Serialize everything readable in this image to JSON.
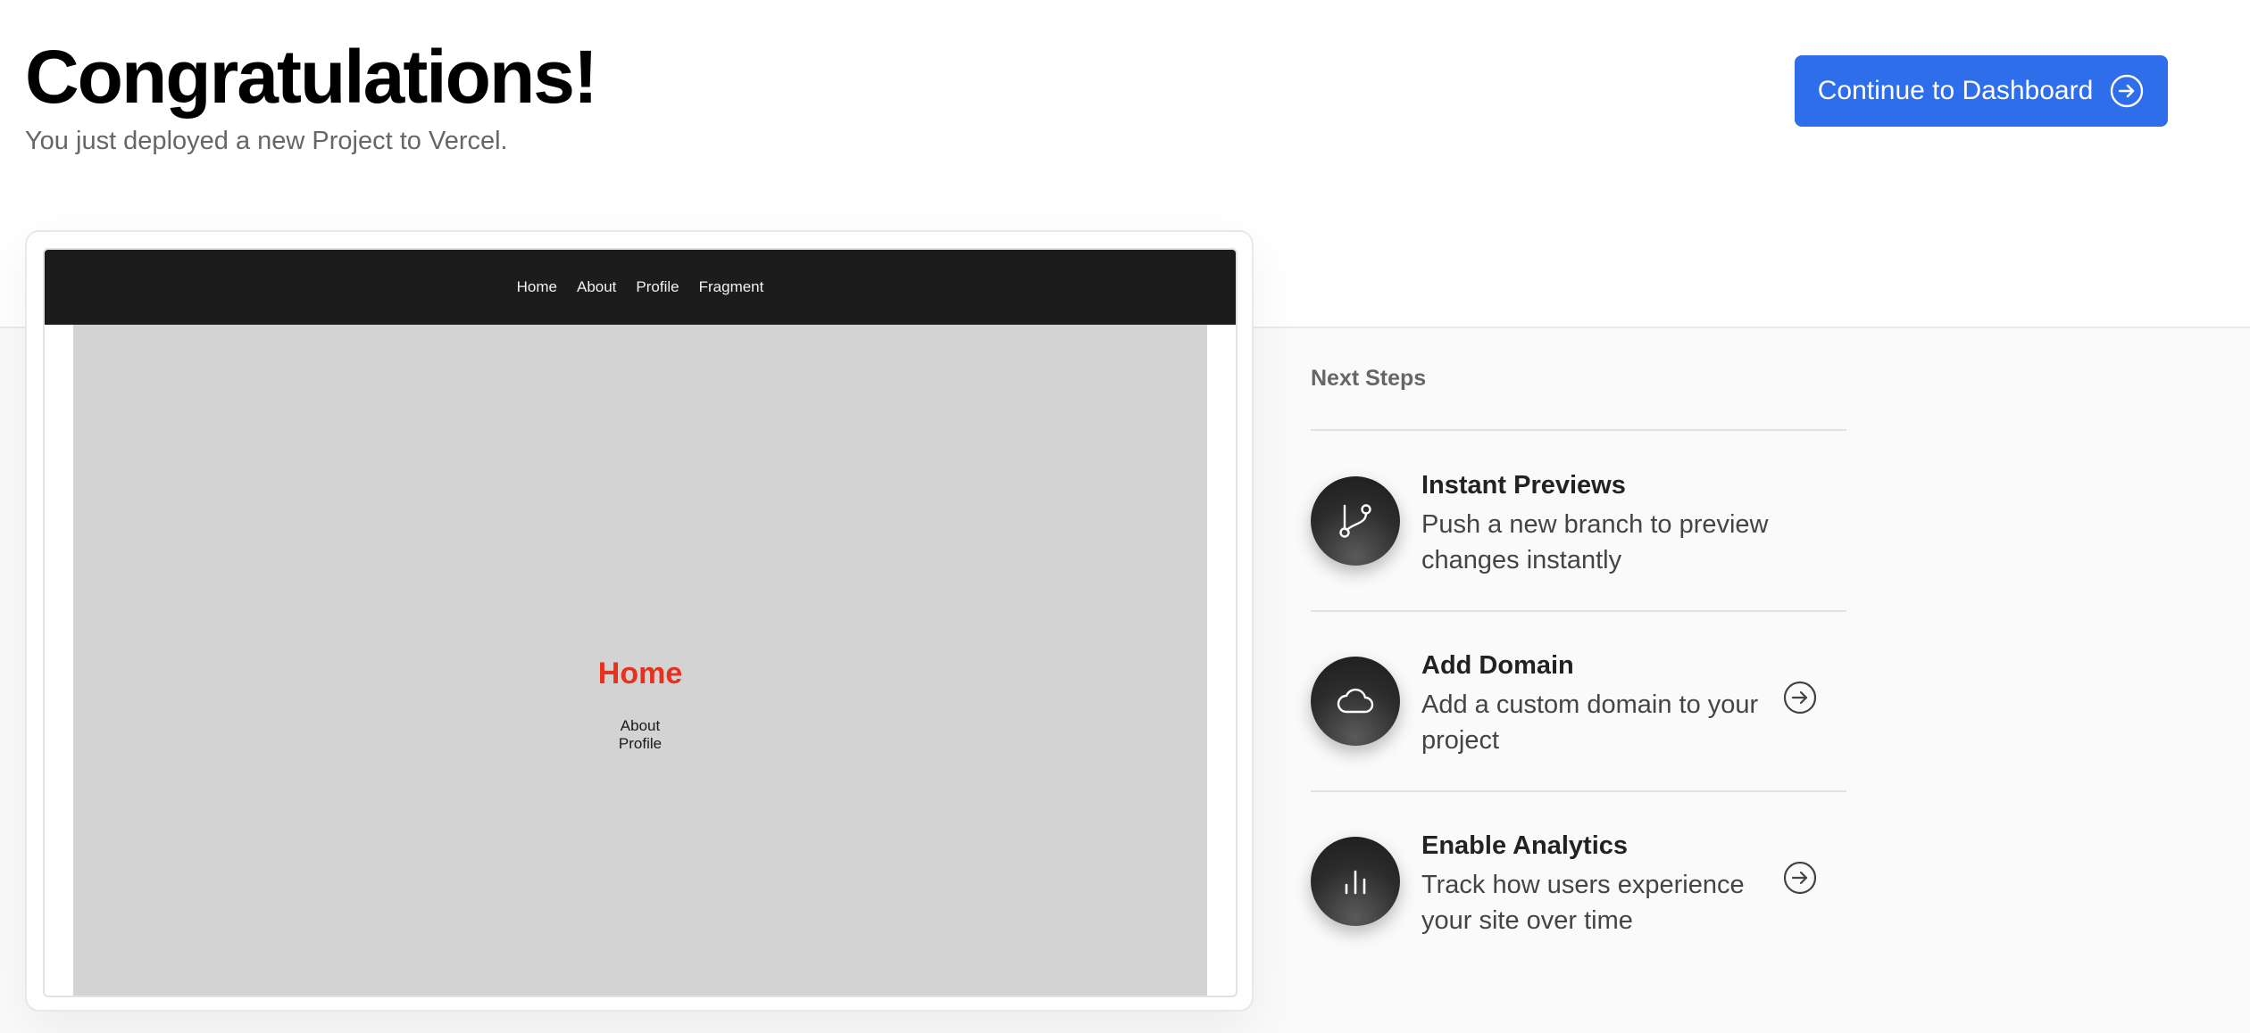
{
  "header": {
    "title": "Congratulations!",
    "subtitle": "You just deployed a new Project to Vercel.",
    "continue_label": "Continue to Dashboard"
  },
  "preview": {
    "nav": [
      "Home",
      "About",
      "Profile",
      "Fragment"
    ],
    "heading": "Home",
    "links": [
      "About",
      "Profile"
    ]
  },
  "next_steps": {
    "title": "Next Steps",
    "items": [
      {
        "title": "Instant Previews",
        "desc": "Push a new branch to preview changes instantly",
        "icon": "git-branch-icon"
      },
      {
        "title": "Add Domain",
        "desc": "Add a custom domain to your project",
        "icon": "cloud-icon"
      },
      {
        "title": "Enable Analytics",
        "desc": "Track how users experience your site over time",
        "icon": "bar-chart-icon"
      }
    ]
  },
  "colors": {
    "accent": "#2f6eea",
    "preview_heading": "#e8301f",
    "preview_nav_bg": "#1c1c1c",
    "preview_body_bg": "#d3d3d3"
  }
}
